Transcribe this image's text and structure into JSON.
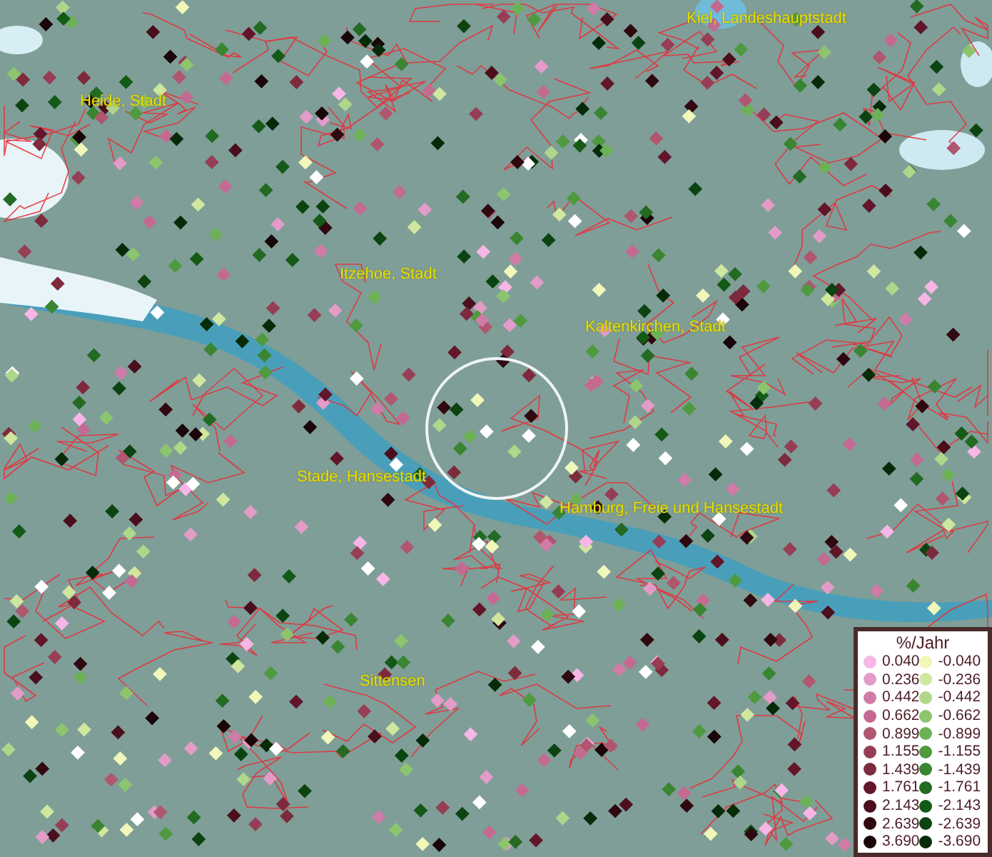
{
  "map": {
    "place_labels": [
      "Kiel, Landeshauptstadt",
      "Heide, Stadt",
      "Itzehoe, Stadt",
      "Kaltenkirchen, Stadt",
      "Stade, Hansestadt",
      "Hamburg, Freie und Hansestadt",
      "Sittensen"
    ]
  },
  "legend": {
    "title": "%/Jahr",
    "rows": [
      {
        "positive": {
          "label": "0.040",
          "color": "#f7b6e6"
        },
        "negative": {
          "label": "-0.040",
          "color": "#f0f7b8"
        }
      },
      {
        "positive": {
          "label": "0.236",
          "color": "#e39bc8"
        },
        "negative": {
          "label": "-0.236",
          "color": "#cfe79f"
        }
      },
      {
        "positive": {
          "label": "0.442",
          "color": "#d17ba8"
        },
        "negative": {
          "label": "-0.442",
          "color": "#afd68a"
        }
      },
      {
        "positive": {
          "label": "0.662",
          "color": "#c46a92"
        },
        "negative": {
          "label": "-0.662",
          "color": "#8cc56e"
        }
      },
      {
        "positive": {
          "label": "0.899",
          "color": "#b0566f"
        },
        "negative": {
          "label": "-0.899",
          "color": "#6db157"
        }
      },
      {
        "positive": {
          "label": "1.155",
          "color": "#963e55"
        },
        "negative": {
          "label": "-1.155",
          "color": "#4f9a3e"
        }
      },
      {
        "positive": {
          "label": "1.439",
          "color": "#7d2a3c"
        },
        "negative": {
          "label": "-1.439",
          "color": "#3a8531"
        }
      },
      {
        "positive": {
          "label": "1.761",
          "color": "#63152a"
        },
        "negative": {
          "label": "-1.761",
          "color": "#236a22"
        }
      },
      {
        "positive": {
          "label": "2.143",
          "color": "#4a0e1c"
        },
        "negative": {
          "label": "-2.143",
          "color": "#145a17"
        }
      },
      {
        "positive": {
          "label": "2.639",
          "color": "#300810"
        },
        "negative": {
          "label": "-2.639",
          "color": "#0b4410"
        }
      },
      {
        "positive": {
          "label": "3.690",
          "color": "#1a0508"
        },
        "negative": {
          "label": "-3.690",
          "color": "#062b08"
        }
      }
    ]
  }
}
